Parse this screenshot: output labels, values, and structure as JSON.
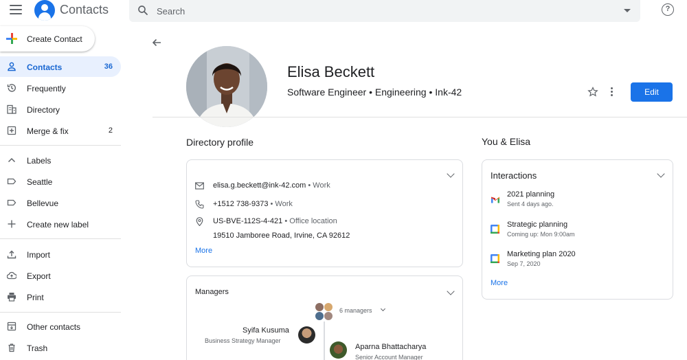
{
  "app": {
    "title": "Contacts"
  },
  "search": {
    "placeholder": "Search"
  },
  "sidebar": {
    "create_label": "Create Contact",
    "items": [
      {
        "label": "Contacts",
        "count": "36"
      },
      {
        "label": "Frequently",
        "count": ""
      },
      {
        "label": "Directory",
        "count": ""
      },
      {
        "label": "Merge & fix",
        "count": "2"
      }
    ],
    "labels_header": "Labels",
    "labels": [
      {
        "label": "Seattle"
      },
      {
        "label": "Bellevue"
      }
    ],
    "create_label_item": "Create new label",
    "actions": [
      {
        "label": "Import"
      },
      {
        "label": "Export"
      },
      {
        "label": "Print"
      }
    ],
    "other": [
      {
        "label": "Other contacts"
      },
      {
        "label": "Trash"
      }
    ]
  },
  "profile": {
    "name": "Elisa Beckett",
    "subtitle": "Software Engineer • Engineering • Ink-42",
    "edit_label": "Edit"
  },
  "directory": {
    "title": "Directory profile",
    "email": "elisa.g.beckett@ink-42.com",
    "email_type": "• Work",
    "phone": "+1512 738-9373",
    "phone_type": "• Work",
    "location_code": "US-BVE-112S-4-421",
    "location_type": "• Office location",
    "address": "19510 Jamboree Road, Irvine, CA 92612",
    "more": "More"
  },
  "managers": {
    "title": "Managers",
    "count_label": "6 managers",
    "people": [
      {
        "name": "Syifa Kusuma",
        "role": "Business Strategy Manager"
      },
      {
        "name": "Aparna Bhattacharya",
        "role": "Senior Account Manager"
      }
    ]
  },
  "you": {
    "title": "You & Elisa",
    "interactions_title": "Interactions",
    "items": [
      {
        "icon": "gmail-icon",
        "title": "2021 planning",
        "sub": "Sent 4 days ago."
      },
      {
        "icon": "calendar-icon",
        "title": "Strategic planning",
        "sub": "Coming up: Mon 9:00am"
      },
      {
        "icon": "calendar-icon",
        "title": "Marketing plan 2020",
        "sub": "Sep 7, 2020"
      }
    ],
    "more": "More"
  },
  "colors": {
    "accent": "#1a73e8",
    "active_bg": "#e8f0fe"
  }
}
